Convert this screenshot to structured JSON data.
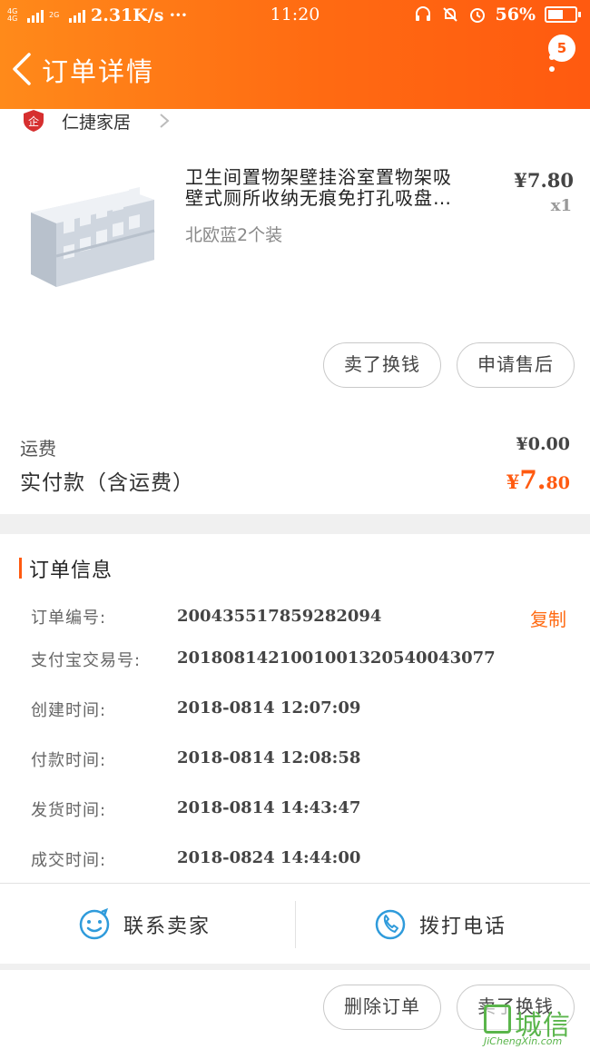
{
  "status_bar": {
    "network_label": "4G 4G",
    "network2_label": "2G",
    "speed": "2.31K/s",
    "dots": "···",
    "time": "11:20",
    "battery_pct": "56%",
    "battery_level": 0.56
  },
  "header": {
    "title": "订单详情",
    "badge_count": "5",
    "accent": "#ff6a12"
  },
  "store": {
    "logo_text": "企",
    "name": "仁捷家居"
  },
  "product": {
    "title_line1": "卫生间置物架壁挂浴室置物架吸",
    "title_line2": "壁式厕所收纳无痕免打孔吸盘…",
    "spec": "北欧蓝2个装",
    "price": "¥7.80",
    "qty": "x1",
    "buttons": {
      "resell": "卖了换钱",
      "after_sale": "申请售后"
    }
  },
  "payment": {
    "shipping_label": "运费",
    "shipping_value": "¥0.00",
    "total_label": "实付款（含运费）",
    "total_currency": "¥",
    "total_int": "7.",
    "total_dec": "80"
  },
  "order_info": {
    "section_title": "订单信息",
    "copy_label": "复制",
    "rows": [
      {
        "label": "订单编号:",
        "value": "200435517859282094"
      },
      {
        "label": "支付宝交易号:",
        "value": "2018081421001001320540043077"
      },
      {
        "label": "创建时间:",
        "value": "2018-0814 12:07:09"
      },
      {
        "label": "付款时间:",
        "value": "2018-0814 12:08:58"
      },
      {
        "label": "发货时间:",
        "value": "2018-0814 14:43:47"
      },
      {
        "label": "成交时间:",
        "value": "2018-0824 14:44:00"
      }
    ]
  },
  "actions": {
    "contact_seller": "联系卖家",
    "call_phone": "拨打电话"
  },
  "bottom_bar": {
    "delete_order": "删除订单",
    "resell": "卖了换钱"
  },
  "watermark": {
    "text": "城信",
    "site": "JiChengXin.com"
  }
}
